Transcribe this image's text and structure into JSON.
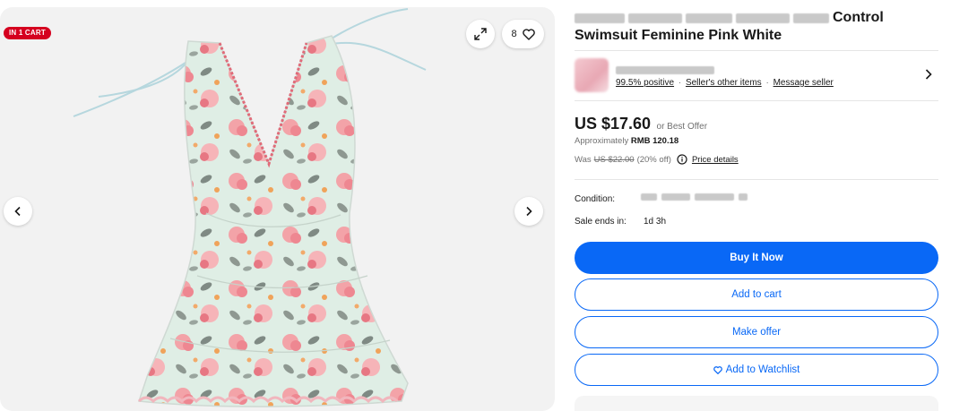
{
  "gallery": {
    "cart_badge": "IN 1 CART",
    "watch_count": "8",
    "icons": [
      "expand-icon",
      "heart-icon",
      "chevron-left-icon",
      "chevron-right-icon"
    ]
  },
  "listing": {
    "title_visible_end": "Control",
    "title_line2": "Swimsuit Feminine Pink White"
  },
  "seller": {
    "feedback": "99.5% positive",
    "other_items": "Seller's other items",
    "message": "Message seller",
    "separator": "·"
  },
  "price": {
    "amount": "US $17.60",
    "best_offer": "or Best Offer",
    "approx_prefix": "Approximately",
    "approx_value": "RMB 120.18",
    "was_prefix": "Was",
    "was_value": "US $22.00",
    "discount": "(20% off)",
    "details_link": "Price details"
  },
  "details": {
    "condition_label": "Condition:",
    "sale_ends_label": "Sale ends in:",
    "sale_ends_value": "1d 3h"
  },
  "actions": {
    "buy_now": "Buy It Now",
    "add_to_cart": "Add to cart",
    "make_offer": "Make offer",
    "watchlist": "Add to Watchlist"
  },
  "colors": {
    "primary_blue": "#0968f6",
    "badge_red": "#d5001f",
    "gallery_bg": "#f2f2f2"
  }
}
